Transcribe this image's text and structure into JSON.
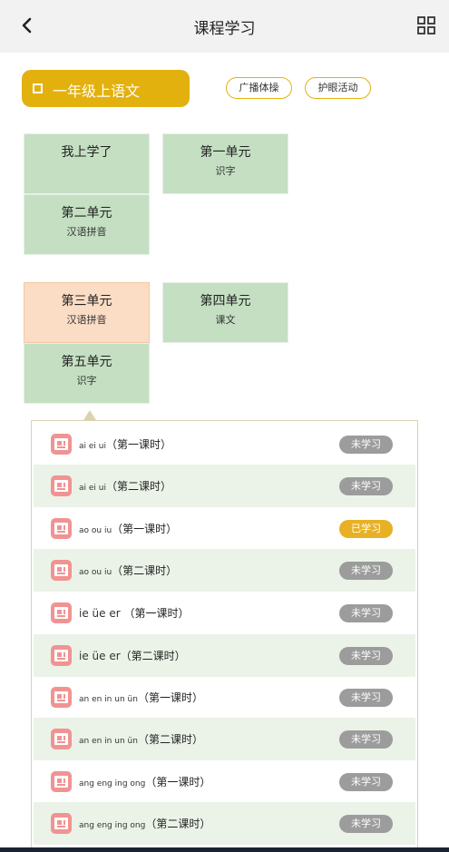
{
  "header": {
    "title": "课程学习",
    "back_icon": "chevron-left-icon",
    "grid_icon": "grid-icon"
  },
  "course": {
    "label": "一年级上语文",
    "color": "#e3b10e"
  },
  "activities": [
    "广播体操",
    "护眼活动"
  ],
  "units": [
    {
      "name": "我上学了",
      "sub": ""
    },
    {
      "name": "第一单元",
      "sub": "识字"
    },
    {
      "name": "第二单元",
      "sub": "汉语拼音"
    },
    {
      "name": "第三单元",
      "sub": "汉语拼音",
      "active": true
    },
    {
      "name": "第四单元",
      "sub": "课文"
    },
    {
      "name": "第五单元",
      "sub": "识字"
    }
  ],
  "lessons": [
    {
      "pinyin": "ai ei ui",
      "session": "（第一课时）",
      "status": "未学习"
    },
    {
      "pinyin": "ai ei ui",
      "session": "（第二课时）",
      "status": "未学习"
    },
    {
      "pinyin": "ao ou iu",
      "session": "（第一课时）",
      "status": "已学习"
    },
    {
      "pinyin": "ao ou iu",
      "session": "（第二课时）",
      "status": "未学习"
    },
    {
      "pinyin": "ie üe er ",
      "session": "（第一课时）",
      "status": "未学习"
    },
    {
      "pinyin": "ie üe er",
      "session": "（第二课时）",
      "status": "未学习"
    },
    {
      "pinyin": "an en in un ün",
      "session": "（第一课时）",
      "status": "未学习"
    },
    {
      "pinyin": "an en in un ün",
      "session": "（第二课时）",
      "status": "未学习"
    },
    {
      "pinyin": "ang eng ing ong",
      "session": "（第一课时）",
      "status": "未学习"
    },
    {
      "pinyin": "ang eng ing ong",
      "session": "（第二课时）",
      "status": "未学习"
    }
  ],
  "status_colors": {
    "未学习": "#9c9c9c",
    "已学习": "#e8b125"
  }
}
